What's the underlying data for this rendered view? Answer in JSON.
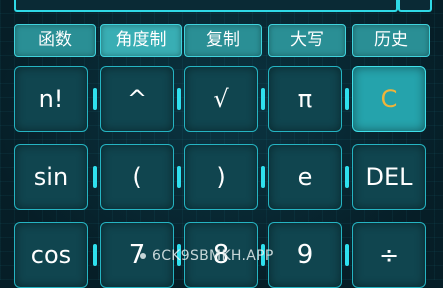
{
  "function_row": [
    "函数",
    "角度制",
    "复制",
    "大写",
    "历史"
  ],
  "keys": {
    "row1": [
      "n!",
      "^",
      "√",
      "π",
      "C"
    ],
    "row2": [
      "sin",
      "(",
      ")",
      "e",
      "DEL"
    ],
    "row3": [
      "cos",
      "7",
      "8",
      "9",
      "÷"
    ]
  },
  "watermark": "6CK9SBMKH.APP",
  "colors": {
    "accent": "#2fd9e6",
    "clear_key_text": "#f0b43a"
  }
}
